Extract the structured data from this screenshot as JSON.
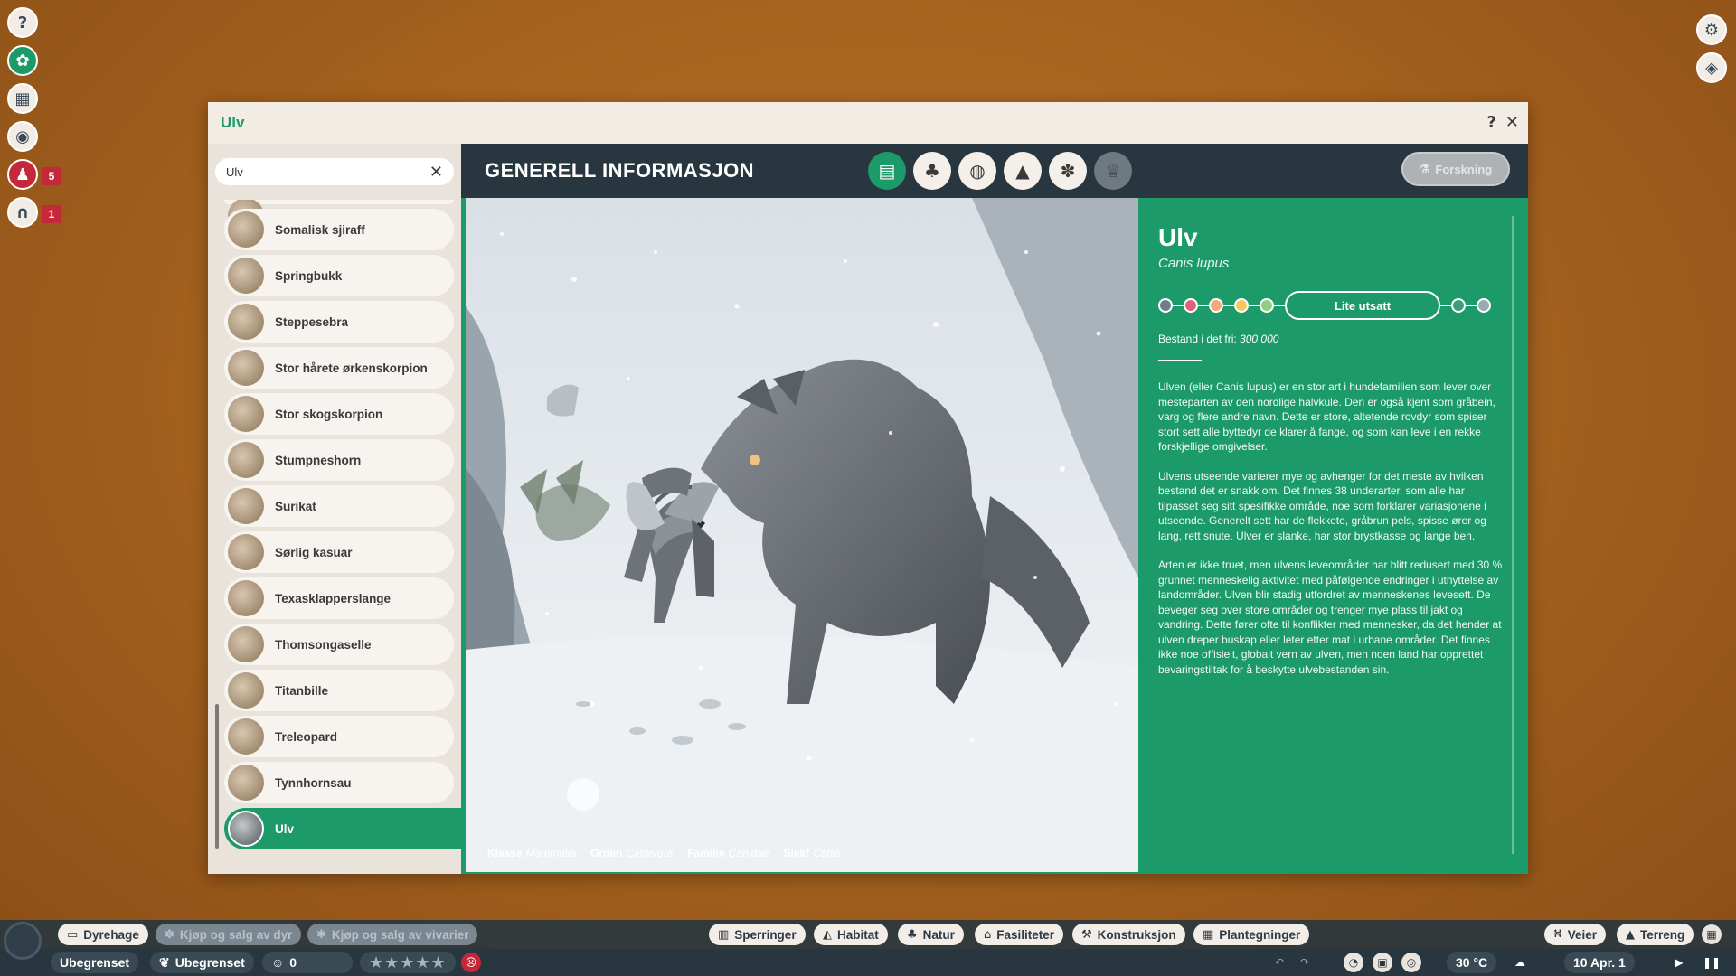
{
  "left_rail": {
    "badges": {
      "guests": "5",
      "staff": "1"
    }
  },
  "window": {
    "title": "Ulv",
    "help_label": "?",
    "close_label": "✕"
  },
  "search": {
    "value": "Ulv",
    "clear_label": "✕"
  },
  "animal_list": [
    {
      "label": "Somalisk sjiraff"
    },
    {
      "label": "Springbukk"
    },
    {
      "label": "Steppesebra"
    },
    {
      "label": "Stor hårete ørkenskorpion"
    },
    {
      "label": "Stor skogskorpion"
    },
    {
      "label": "Stumpneshorn"
    },
    {
      "label": "Surikat"
    },
    {
      "label": "Sørlig kasuar"
    },
    {
      "label": "Texasklapperslange"
    },
    {
      "label": "Thomsongaselle"
    },
    {
      "label": "Titanbille"
    },
    {
      "label": "Treleopard"
    },
    {
      "label": "Tynnhornsau"
    },
    {
      "label": "Ulv",
      "selected": true
    }
  ],
  "content": {
    "header_title": "GENERELL INFORMASJON",
    "research_label": "Forskning",
    "tabs": [
      "clipboard-icon",
      "habitat-icon",
      "drop-icon",
      "enrichment-icon",
      "paw-icon",
      "trophy-icon"
    ]
  },
  "taxonomy": {
    "klasse_label": "Klasse",
    "klasse_value": "Mammalia",
    "orden_label": "Orden",
    "orden_value": "Carnivora",
    "familie_label": "Familie",
    "familie_value": "Canidae",
    "slekt_label": "Slekt",
    "slekt_value": "Canis"
  },
  "info": {
    "name": "Ulv",
    "latin": "Canis lupus",
    "status": "Lite utsatt",
    "status_colors": [
      "#6d7f87",
      "#e0627a",
      "#f4a97a",
      "#f6c75c",
      "#8ccf7e",
      "#ffffff",
      "#3c9e7f",
      "#9aaab1"
    ],
    "population_label": "Bestand i det fri:",
    "population_value": "300 000",
    "paragraphs": [
      "Ulven (eller Canis lupus) er en stor art i hundefamilien som lever over mesteparten av den nordlige halvkule. Den er også kjent som gråbein, varg og flere andre navn. Dette er store, altetende rovdyr som spiser stort sett alle byttedyr de klarer å fange, og som kan leve i en rekke forskjellige omgivelser.",
      "Ulvens utseende varierer mye og avhenger for det meste av hvilken bestand det er snakk om. Det finnes 38 underarter, som alle har tilpasset seg sitt spesifikke område, noe som forklarer variasjonene i utseende. Generelt sett har de flekkete, gråbrun pels, spisse ører og lang, rett snute. Ulver er slanke, har stor brystkasse og lange ben.",
      "Arten er ikke truet, men ulvens leveområder har blitt redusert med 30 % grunnet menneskelig aktivitet med påfølgende endringer i utnyttelse av landområder. Ulven blir stadig utfordret av menneskenes levesett. De beveger seg over store områder og trenger mye plass til jakt og vandring. Dette fører ofte til konflikter med mennesker, da det hender at ulven dreper buskap eller leter etter mat i urbane områder. Det finnes ikke noe offisielt, globalt vern av ulven, men noen land har opprettet bevaringstiltak for å beskytte ulvebestanden sin."
    ]
  },
  "bottom_bar": {
    "menu": {
      "dyrehage": "Dyrehage",
      "kjop_dyr": "Kjøp og salg av dyr",
      "kjop_vivarier": "Kjøp og salg av vivarier",
      "sperringer": "Sperringer",
      "habitat": "Habitat",
      "natur": "Natur",
      "fasiliteter": "Fasiliteter",
      "konstruksjon": "Konstruksjon",
      "plantegninger": "Plantegninger",
      "veier": "Veier",
      "terreng": "Terreng"
    },
    "status": {
      "money": "Ubegrenset",
      "research": "Ubegrenset",
      "guests": "0",
      "temperature": "30 °C",
      "date": "10 Apr. 1"
    }
  }
}
